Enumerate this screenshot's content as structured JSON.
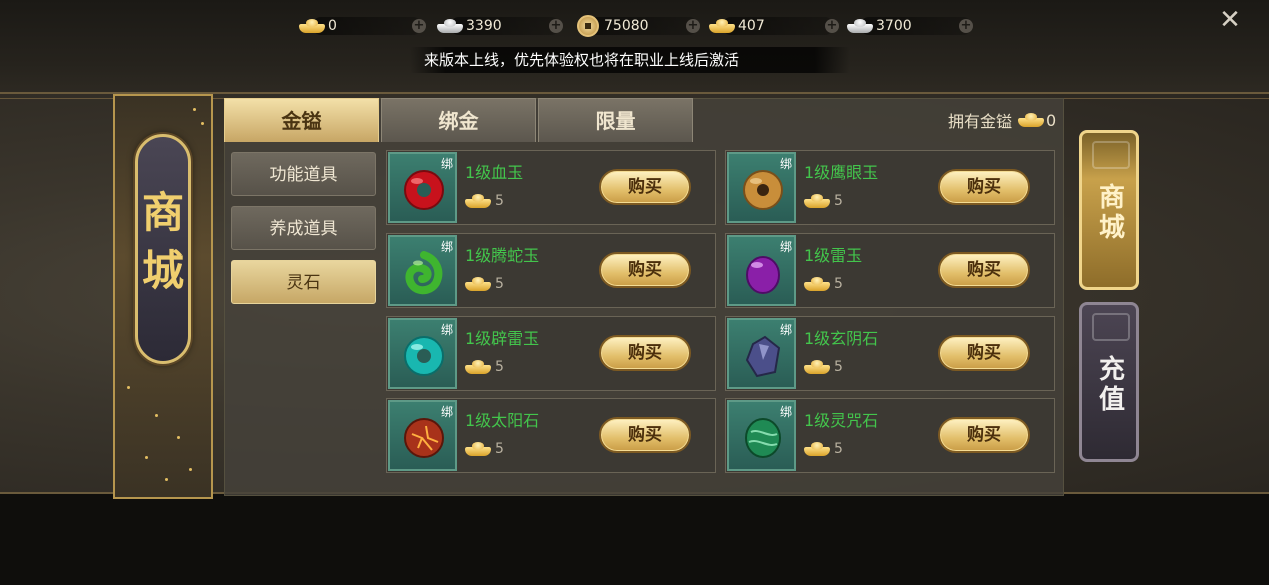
{
  "currencies": [
    {
      "icon": "gold-ingot-icon",
      "value": "0"
    },
    {
      "icon": "silver-ingot-icon",
      "value": "3390"
    },
    {
      "icon": "copper-coin-icon",
      "value": "75080"
    },
    {
      "icon": "bound-gold-ingot-icon",
      "value": "407"
    },
    {
      "icon": "silver-treasure-icon",
      "value": "3700"
    }
  ],
  "notice": "来版本上线，优先体验权也将在职业上线后激活",
  "banner_title": "商城",
  "tabs": [
    "金镒",
    "绑金",
    "限量"
  ],
  "active_tab": 0,
  "owned": {
    "label": "拥有金镒",
    "value": "0"
  },
  "categories": [
    "功能道具",
    "养成道具",
    "灵石"
  ],
  "active_category": 2,
  "buy_label": "购买",
  "bind_label": "绑",
  "items": [
    {
      "name": "1级血玉",
      "price": "5",
      "gem": "red-jade-icon"
    },
    {
      "name": "1级鹰眼玉",
      "price": "5",
      "gem": "hawk-eye-jade-icon"
    },
    {
      "name": "1级腾蛇玉",
      "price": "5",
      "gem": "serpent-jade-icon"
    },
    {
      "name": "1级雷玉",
      "price": "5",
      "gem": "thunder-jade-icon"
    },
    {
      "name": "1级辟雷玉",
      "price": "5",
      "gem": "lightning-ward-jade-icon"
    },
    {
      "name": "1级玄阴石",
      "price": "5",
      "gem": "dark-yin-stone-icon"
    },
    {
      "name": "1级太阳石",
      "price": "5",
      "gem": "sun-stone-icon"
    },
    {
      "name": "1级灵咒石",
      "price": "5",
      "gem": "spirit-curse-stone-icon"
    }
  ],
  "side_tabs": [
    "商城",
    "充值"
  ],
  "colors": {
    "item_name": "#43c54c",
    "accent_gold": "#f0cf6e"
  }
}
